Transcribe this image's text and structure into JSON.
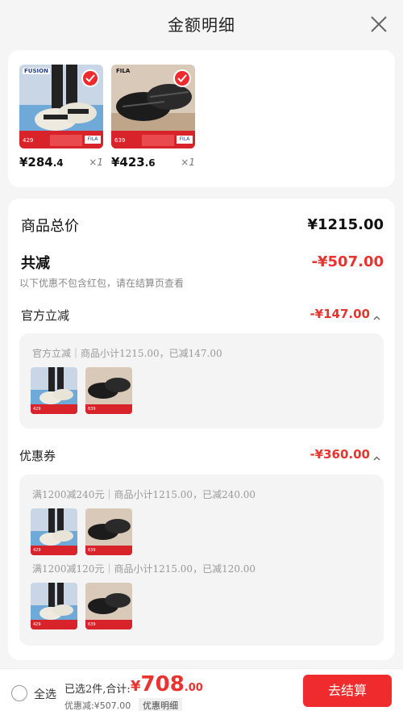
{
  "header": {
    "title": "金额明细"
  },
  "products": [
    {
      "price_main": "¥284",
      "price_dec": ".4",
      "qty": "×1",
      "brand": "FUSION",
      "band_price": "429"
    },
    {
      "price_main": "¥423",
      "price_dec": ".6",
      "qty": "×1",
      "brand": "FILA",
      "band_price": "639"
    }
  ],
  "summary": {
    "total_label": "商品总价",
    "total_amount": "¥1215.00",
    "reduce_label": "共减",
    "reduce_amount": "-¥507.00",
    "note": "以下优惠不包含红包，请在结算页查看"
  },
  "sections": {
    "official": {
      "label": "官方立减",
      "amount": "-¥147.00",
      "line": "官方立减｜商品小计1215.00，已减147.00"
    },
    "coupon": {
      "label": "优惠券",
      "amount": "-¥360.00",
      "line1": "满1200减240元｜商品小计1215.00，已减240.00",
      "line2": "满1200减120元｜商品小计1215.00，已减120.00"
    }
  },
  "footer": {
    "select_all": "全选",
    "selected_summary": "已选2件,合计:",
    "total_currency": "¥",
    "total_int": "708",
    "total_dec": ".00",
    "discount": "优惠减:¥507.00",
    "detail_label": "优惠明细",
    "pay_label": "去结算"
  },
  "colors": {
    "accent": "#ef2b2d",
    "price_red": "#e8332f"
  }
}
